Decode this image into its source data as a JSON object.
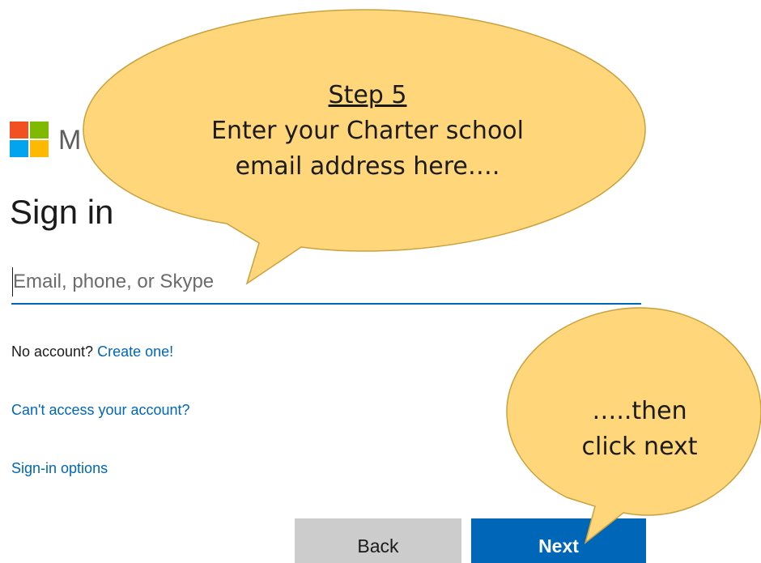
{
  "brand": {
    "name_partial": "M",
    "logo_colors": [
      "#f25022",
      "#7fba00",
      "#00a4ef",
      "#ffb900"
    ]
  },
  "signin": {
    "title": "Sign in",
    "email_placeholder": "Email, phone, or Skype",
    "no_account_text": "No account?",
    "create_link": "Create one!",
    "cant_access_link": "Can't access your account?",
    "signin_options_link": "Sign-in options",
    "back_label": "Back",
    "next_label": "Next"
  },
  "callouts": {
    "step": {
      "heading": "Step 5",
      "line1": "Enter your Charter school",
      "line2": "email address here…."
    },
    "next": {
      "line1": "…..then",
      "line2": "click next"
    },
    "fill_color": "#ffd77a",
    "stroke_color": "#c9a13e"
  },
  "colors": {
    "accent": "#0067b8",
    "button_gray": "#cccccc"
  }
}
